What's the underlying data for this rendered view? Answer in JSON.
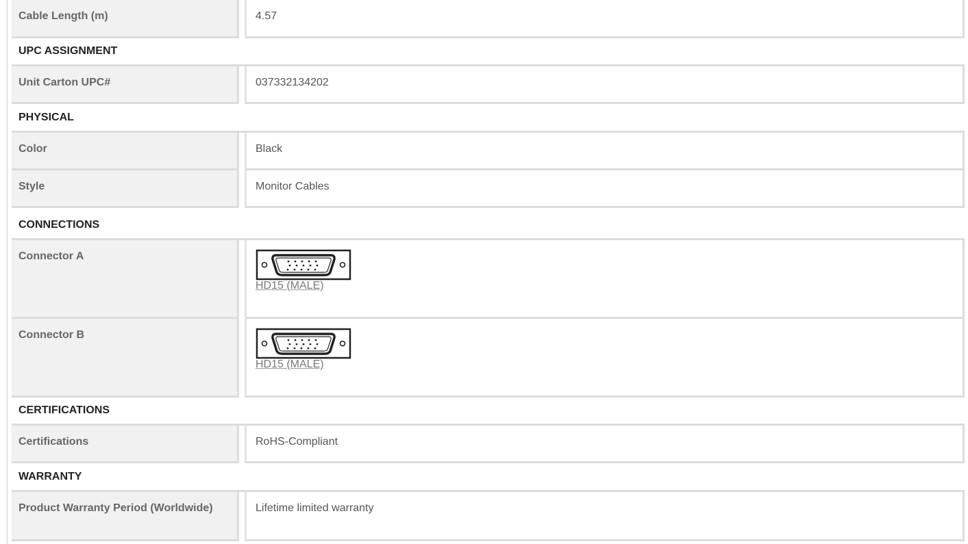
{
  "rows": [
    {
      "type": "spec",
      "label": "Cable Length (m)",
      "value": "4.57"
    },
    {
      "type": "section",
      "title": "UPC ASSIGNMENT"
    },
    {
      "type": "spec",
      "label": "Unit Carton UPC#",
      "value": "037332134202"
    },
    {
      "type": "section",
      "title": "PHYSICAL"
    },
    {
      "type": "spec",
      "label": "Color",
      "value": "Black"
    },
    {
      "type": "spec",
      "label": "Style",
      "value": "Monitor Cables"
    },
    {
      "type": "section",
      "title": "CONNECTIONS"
    },
    {
      "type": "connector",
      "label": "Connector A",
      "value": "HD15 (MALE)",
      "icon": "vga-connector-icon"
    },
    {
      "type": "connector",
      "label": "Connector B",
      "value": "HD15 (MALE)",
      "icon": "vga-connector-icon"
    },
    {
      "type": "section",
      "title": "CERTIFICATIONS"
    },
    {
      "type": "spec",
      "label": "Certifications",
      "value": "RoHS-Compliant"
    },
    {
      "type": "section",
      "title": "WARRANTY"
    },
    {
      "type": "spec",
      "label": "Product Warranty Period (Worldwide)",
      "value": "Lifetime limited warranty"
    }
  ],
  "colors": {
    "label_bg": "#f1f1f1",
    "border": "#dcdcdc",
    "section_text": "#222222",
    "label_text": "#666666",
    "value_text": "#555555"
  }
}
